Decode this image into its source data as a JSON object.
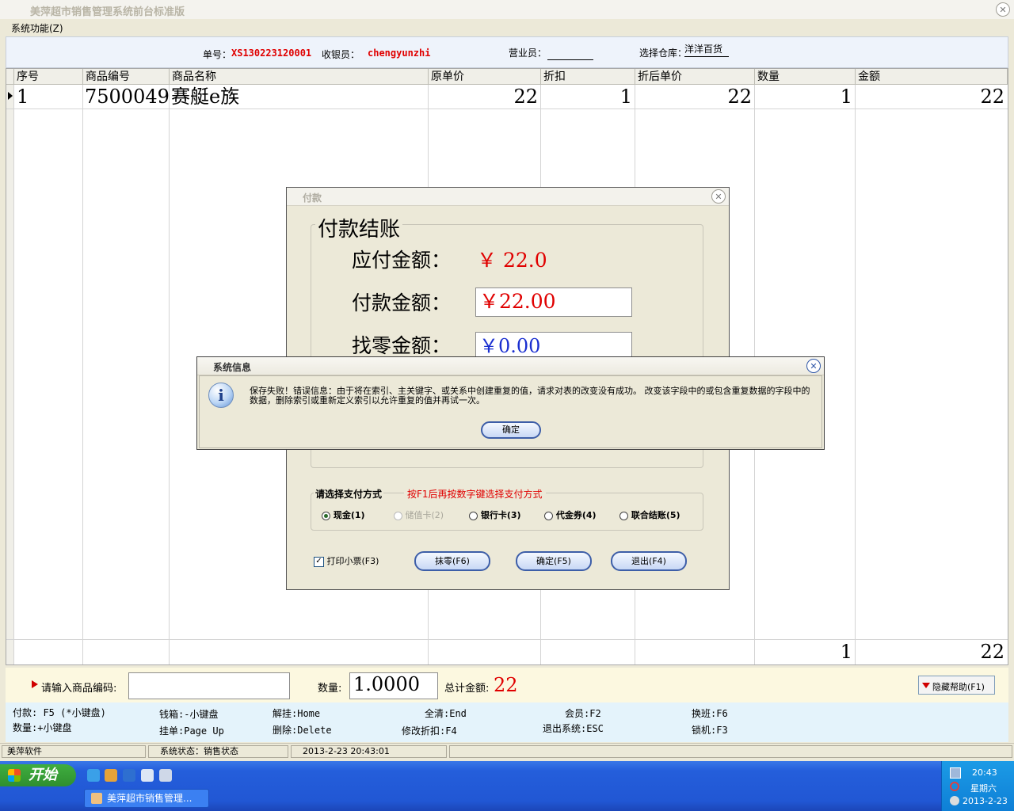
{
  "window": {
    "title": "美萍超市销售管理系统前台标准版",
    "close": "✕"
  },
  "menu": {
    "system": "系统功能(Z)"
  },
  "info": {
    "order_label": "单号：",
    "order_no": "XS130223120001",
    "cashier_label": "收银员：",
    "cashier": "chengyunzhi",
    "clerk_label": "营业员：",
    "warehouse_label": "选择仓库：",
    "warehouse": "洋洋百货"
  },
  "table": {
    "headers": [
      "序号",
      "商品编号",
      "商品名称",
      "原单价",
      "折扣",
      "折后单价",
      "数量",
      "金额"
    ],
    "rows": [
      {
        "seq": "1",
        "code": "7500049",
        "name": "赛艇e族",
        "price": "22",
        "discount": "1",
        "net_price": "22",
        "qty": "1",
        "amount": "22"
      }
    ],
    "totals": {
      "qty": "1",
      "amount": "22"
    }
  },
  "input_bar": {
    "prompt": "请输入商品编码:",
    "code_value": "",
    "qty_label": "数量:",
    "qty_value": "1.0000",
    "total_label": "总计金额:",
    "total_value": "22",
    "hide_help": "隐藏帮助(F1)"
  },
  "help": [
    "付款: F5 (*小键盘)",
    "数量:+小键盘",
    "钱箱:-小键盘",
    "挂单:Page Up",
    "解挂:Home",
    "删除:Delete",
    "全清:End",
    "修改折扣:F4",
    "会员:F2",
    "退出系统:ESC",
    "换班:F6",
    "锁机:F3"
  ],
  "status": {
    "company": "美萍软件",
    "state": "系统状态：销售状态",
    "datetime": "2013-2-23 20:43:01"
  },
  "payment": {
    "title": "付款",
    "group_title": "付款结账",
    "due_label": "应付金额：",
    "due_value": "￥ 22.0",
    "paid_label": "付款金额：",
    "paid_value": "￥22.00",
    "change_label": "找零金额：",
    "change_value": "￥0.00",
    "method_title": "请选择支付方式",
    "method_hint": "按F1后再按数字键选择支付方式",
    "methods": [
      "现金(1)",
      "储值卡(2)",
      "银行卡(3)",
      "代金券(4)",
      "联合结账(5)"
    ],
    "print_label": "打印小票(F3)",
    "btn_round": "抹零(F6)",
    "btn_ok": "确定(F5)",
    "btn_exit": "退出(F4)"
  },
  "message": {
    "title": "系统信息",
    "text": "保存失败！错误信息：由于将在索引、主关键字、或关系中创建重复的值，请求对表的改变没有成功。 改变该字段中的或包含重复数据的字段中的数据，删除索引或重新定义索引以允许重复的值并再试一次。",
    "ok": "确定"
  },
  "taskbar": {
    "start": "开始",
    "task": "美萍超市销售管理...",
    "time": "20:43",
    "weekday": "星期六",
    "date": "2013-2-23"
  },
  "colors": {
    "accent_red": "#e00000",
    "amount_blue": "#1a2fd0",
    "taskbar_blue": "#245edb"
  }
}
